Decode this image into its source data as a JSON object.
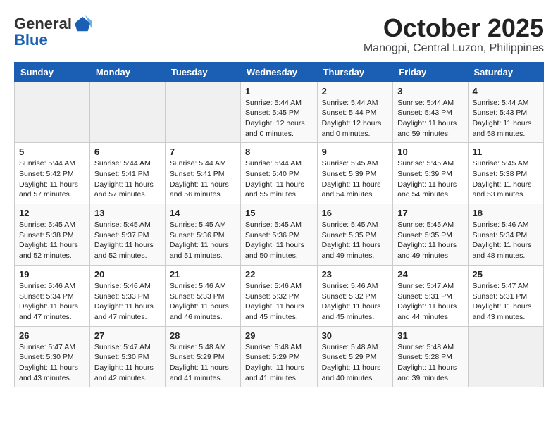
{
  "header": {
    "logo_general": "General",
    "logo_blue": "Blue",
    "month": "October 2025",
    "location": "Manogpi, Central Luzon, Philippines"
  },
  "weekdays": [
    "Sunday",
    "Monday",
    "Tuesday",
    "Wednesday",
    "Thursday",
    "Friday",
    "Saturday"
  ],
  "weeks": [
    [
      {
        "day": "",
        "info": ""
      },
      {
        "day": "",
        "info": ""
      },
      {
        "day": "",
        "info": ""
      },
      {
        "day": "1",
        "info": "Sunrise: 5:44 AM\nSunset: 5:45 PM\nDaylight: 12 hours\nand 0 minutes."
      },
      {
        "day": "2",
        "info": "Sunrise: 5:44 AM\nSunset: 5:44 PM\nDaylight: 12 hours\nand 0 minutes."
      },
      {
        "day": "3",
        "info": "Sunrise: 5:44 AM\nSunset: 5:43 PM\nDaylight: 11 hours\nand 59 minutes."
      },
      {
        "day": "4",
        "info": "Sunrise: 5:44 AM\nSunset: 5:43 PM\nDaylight: 11 hours\nand 58 minutes."
      }
    ],
    [
      {
        "day": "5",
        "info": "Sunrise: 5:44 AM\nSunset: 5:42 PM\nDaylight: 11 hours\nand 57 minutes."
      },
      {
        "day": "6",
        "info": "Sunrise: 5:44 AM\nSunset: 5:41 PM\nDaylight: 11 hours\nand 57 minutes."
      },
      {
        "day": "7",
        "info": "Sunrise: 5:44 AM\nSunset: 5:41 PM\nDaylight: 11 hours\nand 56 minutes."
      },
      {
        "day": "8",
        "info": "Sunrise: 5:44 AM\nSunset: 5:40 PM\nDaylight: 11 hours\nand 55 minutes."
      },
      {
        "day": "9",
        "info": "Sunrise: 5:45 AM\nSunset: 5:39 PM\nDaylight: 11 hours\nand 54 minutes."
      },
      {
        "day": "10",
        "info": "Sunrise: 5:45 AM\nSunset: 5:39 PM\nDaylight: 11 hours\nand 54 minutes."
      },
      {
        "day": "11",
        "info": "Sunrise: 5:45 AM\nSunset: 5:38 PM\nDaylight: 11 hours\nand 53 minutes."
      }
    ],
    [
      {
        "day": "12",
        "info": "Sunrise: 5:45 AM\nSunset: 5:38 PM\nDaylight: 11 hours\nand 52 minutes."
      },
      {
        "day": "13",
        "info": "Sunrise: 5:45 AM\nSunset: 5:37 PM\nDaylight: 11 hours\nand 52 minutes."
      },
      {
        "day": "14",
        "info": "Sunrise: 5:45 AM\nSunset: 5:36 PM\nDaylight: 11 hours\nand 51 minutes."
      },
      {
        "day": "15",
        "info": "Sunrise: 5:45 AM\nSunset: 5:36 PM\nDaylight: 11 hours\nand 50 minutes."
      },
      {
        "day": "16",
        "info": "Sunrise: 5:45 AM\nSunset: 5:35 PM\nDaylight: 11 hours\nand 49 minutes."
      },
      {
        "day": "17",
        "info": "Sunrise: 5:45 AM\nSunset: 5:35 PM\nDaylight: 11 hours\nand 49 minutes."
      },
      {
        "day": "18",
        "info": "Sunrise: 5:46 AM\nSunset: 5:34 PM\nDaylight: 11 hours\nand 48 minutes."
      }
    ],
    [
      {
        "day": "19",
        "info": "Sunrise: 5:46 AM\nSunset: 5:34 PM\nDaylight: 11 hours\nand 47 minutes."
      },
      {
        "day": "20",
        "info": "Sunrise: 5:46 AM\nSunset: 5:33 PM\nDaylight: 11 hours\nand 47 minutes."
      },
      {
        "day": "21",
        "info": "Sunrise: 5:46 AM\nSunset: 5:33 PM\nDaylight: 11 hours\nand 46 minutes."
      },
      {
        "day": "22",
        "info": "Sunrise: 5:46 AM\nSunset: 5:32 PM\nDaylight: 11 hours\nand 45 minutes."
      },
      {
        "day": "23",
        "info": "Sunrise: 5:46 AM\nSunset: 5:32 PM\nDaylight: 11 hours\nand 45 minutes."
      },
      {
        "day": "24",
        "info": "Sunrise: 5:47 AM\nSunset: 5:31 PM\nDaylight: 11 hours\nand 44 minutes."
      },
      {
        "day": "25",
        "info": "Sunrise: 5:47 AM\nSunset: 5:31 PM\nDaylight: 11 hours\nand 43 minutes."
      }
    ],
    [
      {
        "day": "26",
        "info": "Sunrise: 5:47 AM\nSunset: 5:30 PM\nDaylight: 11 hours\nand 43 minutes."
      },
      {
        "day": "27",
        "info": "Sunrise: 5:47 AM\nSunset: 5:30 PM\nDaylight: 11 hours\nand 42 minutes."
      },
      {
        "day": "28",
        "info": "Sunrise: 5:48 AM\nSunset: 5:29 PM\nDaylight: 11 hours\nand 41 minutes."
      },
      {
        "day": "29",
        "info": "Sunrise: 5:48 AM\nSunset: 5:29 PM\nDaylight: 11 hours\nand 41 minutes."
      },
      {
        "day": "30",
        "info": "Sunrise: 5:48 AM\nSunset: 5:29 PM\nDaylight: 11 hours\nand 40 minutes."
      },
      {
        "day": "31",
        "info": "Sunrise: 5:48 AM\nSunset: 5:28 PM\nDaylight: 11 hours\nand 39 minutes."
      },
      {
        "day": "",
        "info": ""
      }
    ]
  ]
}
